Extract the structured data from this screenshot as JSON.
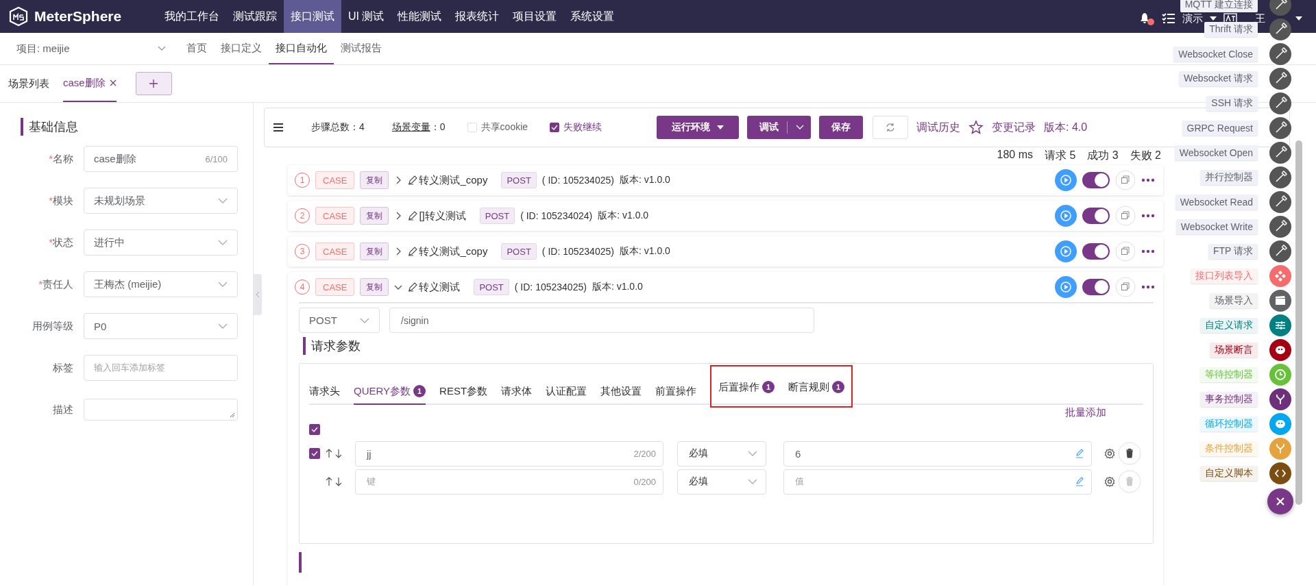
{
  "app": {
    "name": "MeterSphere"
  },
  "top_nav": [
    {
      "label": "我的工作台",
      "selected": false
    },
    {
      "label": "测试跟踪",
      "selected": false
    },
    {
      "label": "接口测试",
      "selected": true
    },
    {
      "label": "UI 测试",
      "selected": false
    },
    {
      "label": "性能测试",
      "selected": false
    },
    {
      "label": "报表统计",
      "selected": false
    },
    {
      "label": "项目设置",
      "selected": false
    },
    {
      "label": "系统设置",
      "selected": false
    }
  ],
  "header_right": {
    "workspace": "演示",
    "user": "王",
    "notification": true
  },
  "project_select": {
    "value": "项目: meijie"
  },
  "sub_nav": [
    {
      "label": "首页",
      "selected": false
    },
    {
      "label": "接口定义",
      "selected": false
    },
    {
      "label": "接口自动化",
      "selected": true
    },
    {
      "label": "测试报告",
      "selected": false
    }
  ],
  "scenario_tabs": {
    "list_label": "场景列表",
    "tabs": [
      {
        "label": "case删除",
        "selected": true
      }
    ]
  },
  "basic_info": {
    "title": "基础信息",
    "required_mark": "*",
    "fields": [
      {
        "label": "名称",
        "required": true,
        "kind": "text",
        "value": "case删除",
        "counter": "6/100"
      },
      {
        "label": "模块",
        "required": true,
        "kind": "select",
        "value": "未规划场景"
      },
      {
        "label": "状态",
        "required": true,
        "kind": "select",
        "value": "进行中"
      },
      {
        "label": "责任人",
        "required": true,
        "kind": "select",
        "value": "王梅杰 (meijie)"
      },
      {
        "label": "用例等级",
        "required": false,
        "kind": "select",
        "value": "P0"
      },
      {
        "label": "标签",
        "required": false,
        "kind": "text",
        "placeholder": "输入回车添加标签"
      },
      {
        "label": "描述",
        "required": false,
        "kind": "textarea"
      }
    ]
  },
  "toolbar": {
    "step_count": "步骤总数：4",
    "variables_link": "场景变量",
    "variables_count": "：0",
    "checkboxes": [
      {
        "label": "共享cookie",
        "checked": false
      },
      {
        "label": "失败继续",
        "checked": true
      }
    ],
    "env_button": "运行环境",
    "debug_button": "调试",
    "save_button": "保存",
    "history_link": "调试历史",
    "changes_link": "变更记录",
    "version": "版本: 4.0"
  },
  "summary": [
    "180 ms",
    "请求 5",
    "成功 3",
    "失败 2"
  ],
  "steps": [
    {
      "index": "1",
      "type": "CASE",
      "tag": "复制",
      "name": "转义测试_copy",
      "method": "POST",
      "id": "( ID: 105234025)",
      "version": "版本: v1.0.0",
      "expanded": false,
      "enabled": true
    },
    {
      "index": "2",
      "type": "CASE",
      "tag": "复制",
      "name": "[]转义测试",
      "method": "POST",
      "id": "( ID: 105234024)",
      "version": "版本: v1.0.0",
      "expanded": false,
      "enabled": true
    },
    {
      "index": "3",
      "type": "CASE",
      "tag": "复制",
      "name": "转义测试_copy",
      "method": "POST",
      "id": "( ID: 105234025)",
      "version": "版本: v1.0.0",
      "expanded": false,
      "enabled": true
    },
    {
      "index": "4",
      "type": "CASE",
      "tag": "复制",
      "name": "转义测试",
      "method": "POST",
      "id": "( ID: 105234025)",
      "version": "版本: v1.0.0",
      "expanded": true,
      "enabled": true
    }
  ],
  "request": {
    "method": "POST",
    "url": "/signin",
    "section_title": "请求参数",
    "tabs": [
      {
        "label": "请求头",
        "selected": false,
        "highlighted": false
      },
      {
        "label": "QUERY参数",
        "count": "1",
        "selected": true,
        "highlighted": false
      },
      {
        "label": "REST参数",
        "selected": false,
        "highlighted": false
      },
      {
        "label": "请求体",
        "selected": false,
        "highlighted": false
      },
      {
        "label": "认证配置",
        "selected": false,
        "highlighted": false
      },
      {
        "label": "其他设置",
        "selected": false,
        "highlighted": false
      },
      {
        "label": "前置操作",
        "selected": false,
        "highlighted": false
      },
      {
        "label": "后置操作",
        "count": "1",
        "selected": false,
        "highlighted": true
      },
      {
        "label": "断言规则",
        "count": "1",
        "selected": false,
        "highlighted": true
      }
    ],
    "batch_add": "批量添加",
    "select_all": true,
    "params": [
      {
        "kind": "filled",
        "checked": true,
        "key": "jj",
        "key_counter": "2/200",
        "required": "必填",
        "value": "6",
        "deletable": true
      },
      {
        "kind": "new",
        "key_placeholder": "键",
        "key_counter": "0/200",
        "required": "必填",
        "value_placeholder": "值",
        "deletable": false
      }
    ]
  },
  "add_menu": [
    {
      "label": "MQTT 建立连接",
      "kind": "plugin",
      "color": "#555555"
    },
    {
      "label": "Thrift 请求",
      "kind": "plugin",
      "color": "#555555"
    },
    {
      "label": "Websocket Close",
      "kind": "plugin",
      "color": "#555555"
    },
    {
      "label": "Websocket 请求",
      "kind": "plugin",
      "color": "#555555"
    },
    {
      "label": "SSH 请求",
      "kind": "plugin",
      "color": "#555555"
    },
    {
      "label": "GRPC Request",
      "kind": "plugin",
      "color": "#555555"
    },
    {
      "label": "Websocket Open",
      "kind": "plugin",
      "color": "#555555"
    },
    {
      "label": "并行控制器",
      "kind": "plugin",
      "color": "#555555"
    },
    {
      "label": "Websocket Read",
      "kind": "plugin",
      "color": "#555555"
    },
    {
      "label": "Websocket Write",
      "kind": "plugin",
      "color": "#555555"
    },
    {
      "label": "FTP 请求",
      "kind": "plugin",
      "color": "#555555"
    },
    {
      "label": "接口列表导入",
      "kind": "import",
      "color": "#f56c6c"
    },
    {
      "label": "场景导入",
      "kind": "scene",
      "color": "#606266"
    },
    {
      "label": "自定义请求",
      "kind": "custom",
      "color": "#008080"
    },
    {
      "label": "场景断言",
      "kind": "blob",
      "color": "#a30014"
    },
    {
      "label": "等待控制器",
      "kind": "clock",
      "color": "#67c23a"
    },
    {
      "label": "事务控制器",
      "kind": "fork",
      "color": "#6d317c"
    },
    {
      "label": "循环控制器",
      "kind": "blob",
      "color": "#02a7f0"
    },
    {
      "label": "条件控制器",
      "kind": "fork",
      "color": "#e6a23c"
    },
    {
      "label": "自定义脚本",
      "kind": "code",
      "color": "#7b4d12"
    }
  ]
}
